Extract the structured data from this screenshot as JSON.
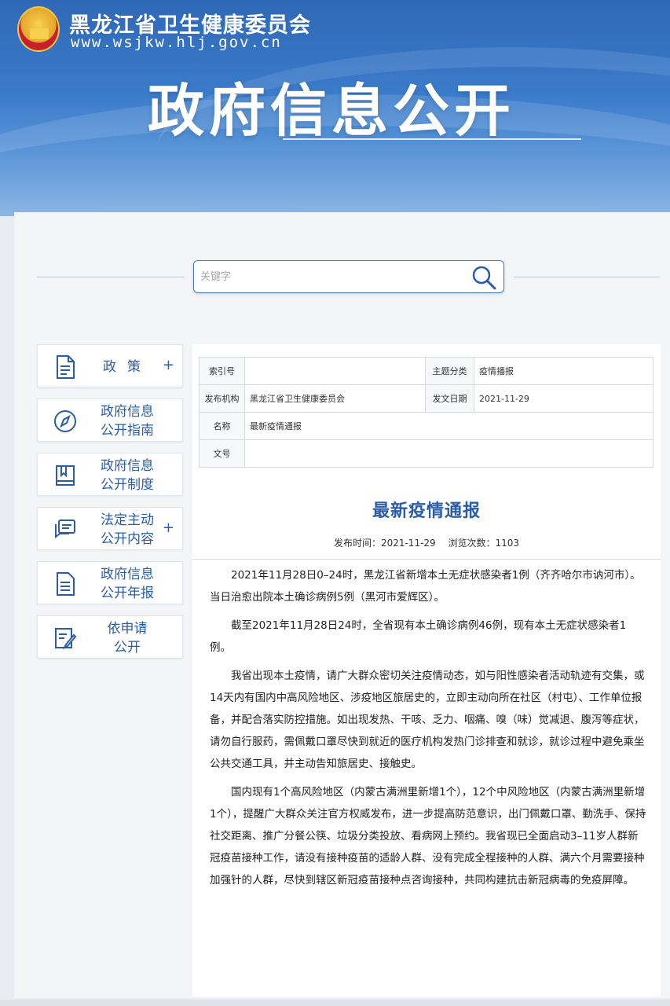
{
  "header": {
    "site_name": "黑龙江省卫生健康委员会",
    "site_url": "www.wsjkw.hlj.gov.cn",
    "banner_title": "政府信息公开"
  },
  "search": {
    "placeholder": "关键字",
    "icon": "search-icon"
  },
  "sidebar": {
    "items": [
      {
        "label": "政策",
        "icon": "document-icon",
        "expandable": "+"
      },
      {
        "label": "政府信息\n公开指南",
        "icon": "compass-icon"
      },
      {
        "label": "政府信息\n公开制度",
        "icon": "book-icon"
      },
      {
        "label": "法定主动\n公开内容",
        "icon": "chat-icon",
        "expandable": "+"
      },
      {
        "label": "政府信息\n公开年报",
        "icon": "report-icon"
      },
      {
        "label": "依申请\n公开",
        "icon": "edit-icon"
      }
    ]
  },
  "meta_table": {
    "index_label": "索引号",
    "index_value": "",
    "topic_label": "主题分类",
    "topic_value": "疫情播报",
    "org_label": "发布机构",
    "org_value": "黑龙江省卫生健康委员会",
    "date_label": "发文日期",
    "date_value": "2021-11-29",
    "name_label": "名称",
    "name_value": "最新疫情通报",
    "docno_label": "文号",
    "docno_value": ""
  },
  "article": {
    "title": "最新疫情通报",
    "publish_time": "发布时间：2021-11-29",
    "views": "浏览次数：1103",
    "paragraphs": [
      "2021年11月28日0–24时，黑龙江省新增本土无症状感染者1例（齐齐哈尔市讷河市）。当日治愈出院本土确诊病例5例（黑河市爱辉区）。",
      "截至2021年11月28日24时，全省现有本土确诊病例46例，现有本土无症状感染者1例。",
      "我省出现本土疫情，请广大群众密切关注疫情动态，如与阳性感染者活动轨迹有交集，或14天内有国内中高风险地区、涉疫地区旅居史的，立即主动向所在社区（村屯）、工作单位报备，并配合落实防控措施。如出现发热、干咳、乏力、咽痛、嗅（味）觉减退、腹泻等症状，请勿自行服药，需佩戴口罩尽快到就近的医疗机构发热门诊排查和就诊，就诊过程中避免乘坐公共交通工具，并主动告知旅居史、接触史。",
      "国内现有1个高风险地区（内蒙古满洲里新增1个），12个中风险地区（内蒙古满洲里新增1个），提醒广大群众关注官方权威发布，进一步提高防范意识，出门佩戴口罩、勤洗手、保持社交距离、推广分餐公筷、垃圾分类投放、看病网上预约。我省现已全面启动3–11岁人群新冠疫苗接种工作，请没有接种疫苗的适龄人群、没有完成全程接种的人群、满六个月需要接种加强针的人群，尽快到辖区新冠疫苗接种点咨询接种，共同构建抗击新冠病毒的免疫屏障。"
    ]
  },
  "colors": {
    "brand_blue": "#2a5ca8",
    "banner_blue": "#3b7ccb"
  }
}
